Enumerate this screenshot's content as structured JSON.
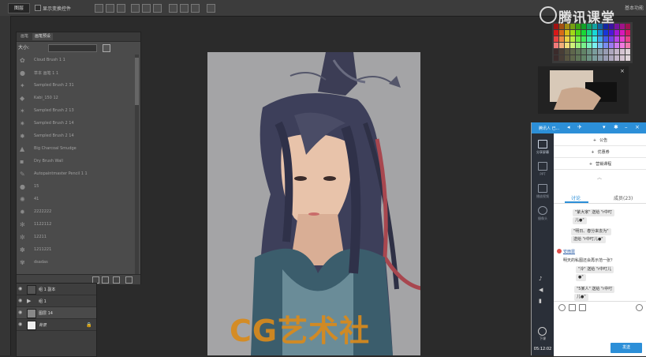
{
  "top_bar": {
    "mode_select": "图层",
    "checkbox_label": "显示变换控件",
    "right_label": "基本功能"
  },
  "brush_panel": {
    "tabs": [
      "画笔",
      "画笔预设"
    ],
    "size_label": "大小:",
    "items": [
      {
        "icon": "cloud-brush-icon",
        "name": "Cloud Brush 1 1"
      },
      {
        "icon": "soft-brush-icon",
        "name": "草本 画笔 1 1"
      },
      {
        "icon": "sampled-brush-icon",
        "name": "Sampled Brush 2 31"
      },
      {
        "icon": "kabi-brush-icon",
        "name": "Kabi_150 12"
      },
      {
        "icon": "sampled-brush-icon",
        "name": "Sampled Brush 2 13"
      },
      {
        "icon": "sampled-brush-icon",
        "name": "Sampled Brush 2 14"
      },
      {
        "icon": "sampled-brush-icon",
        "name": "Sampled Brush 2 14"
      },
      {
        "icon": "charcoal-brush-icon",
        "name": "Big Charcoal Smudge"
      },
      {
        "icon": "dry-brush-icon",
        "name": "Dry Brush Wall"
      },
      {
        "icon": "pencil-brush-icon",
        "name": "Autopaintmaster Pencil 1 1"
      },
      {
        "icon": "round-brush-icon",
        "name": "15"
      },
      {
        "icon": "brush-icon",
        "name": "41"
      },
      {
        "icon": "brush-icon",
        "name": "2222222"
      },
      {
        "icon": "brush-icon",
        "name": "1122112"
      },
      {
        "icon": "brush-icon",
        "name": "12211"
      },
      {
        "icon": "brush-icon",
        "name": "1211221"
      },
      {
        "icon": "brush-icon",
        "name": "dsadas"
      }
    ]
  },
  "layers": [
    {
      "name": "组 1 副本",
      "kind": "group",
      "visible": true
    },
    {
      "name": "组 1",
      "kind": "group",
      "visible": true
    },
    {
      "name": "图层 14",
      "kind": "layer",
      "visible": true
    },
    {
      "name": "背景",
      "kind": "background",
      "visible": true
    }
  ],
  "canvas": {
    "watermark": "CG艺术社",
    "bg_color": "#a4a4a6",
    "watermark_color": "#d98a1c"
  },
  "brand": {
    "text": "腾讯课堂"
  },
  "chat": {
    "title": "腾讯人 已...",
    "header_color": "#2c8fd8",
    "side_items": [
      {
        "icon": "share-screen-icon",
        "label": "分享屏幕"
      },
      {
        "icon": "ppt-icon",
        "label": "PPT"
      },
      {
        "icon": "video-icon",
        "label": "播放视频"
      },
      {
        "icon": "camera-icon",
        "label": "摄像头"
      }
    ],
    "menu": [
      "公告",
      "优惠券",
      "营销课程"
    ],
    "tabs": [
      "讨论",
      "成员(23)"
    ],
    "messages": [
      "\"紫大家\" 送给 \"r中叮",
      "儿●\"",
      "\"明日、春分来去为\"",
      "送给 \"r中叮儿●\"",
      "安雨霏",
      "明天的私图还会再示范一张？",
      "\"泠\" 送给 \"r中叮儿",
      "●\"",
      "\"5某人\" 送给 \"r中叮",
      "儿●\""
    ],
    "time": "05:12:02",
    "download_label": "下课",
    "send_label": "发送"
  }
}
